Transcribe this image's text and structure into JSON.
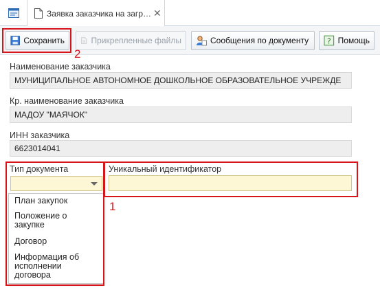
{
  "tab": {
    "title": "Заявка заказчика на загр…",
    "close": "✕"
  },
  "toolbar": {
    "save": "Сохранить",
    "attached": "Прикрепленные файлы",
    "messages": "Сообщения по документу",
    "help": "Помощь"
  },
  "form": {
    "customer_name_label": "Наименование заказчика",
    "customer_name_value": "МУНИЦИПАЛЬНОЕ АВТОНОМНОЕ ДОШКОЛЬНОЕ ОБРАЗОВАТЕЛЬНОЕ УЧРЕЖДЕ",
    "short_name_label": "Кр. наименование заказчика",
    "short_name_value": "МАДОУ \"МАЯЧОК\"",
    "inn_label": "ИНН заказчика",
    "inn_value": "6623014041",
    "doc_type_label": "Тип документа",
    "doc_type_value": "",
    "uid_label": "Уникальный идентификатор",
    "uid_value": ""
  },
  "dropdown": {
    "options": [
      "План закупок",
      "Положение о закупке",
      "Договор",
      "Информация об исполнении договора"
    ]
  },
  "annotations": {
    "first": "1",
    "second": "2"
  },
  "colors": {
    "highlight": "#d7141a",
    "required_field": "#fdf7d6"
  }
}
